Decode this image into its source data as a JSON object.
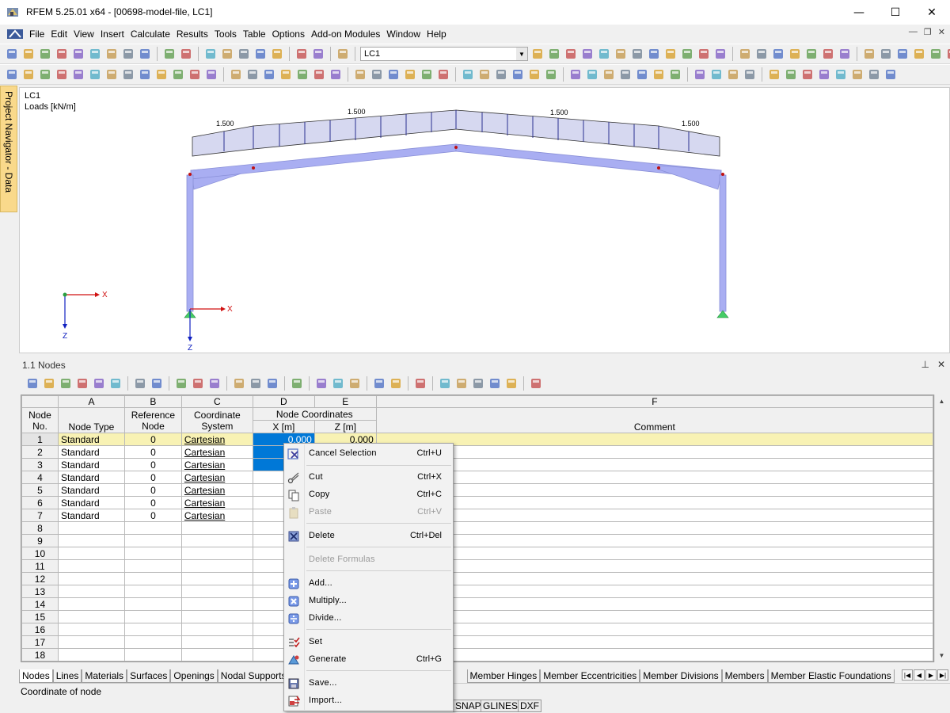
{
  "window": {
    "title": "RFEM 5.25.01 x64 - [00698-model-file, LC1]",
    "minimize": "—",
    "maximize": "☐",
    "close": "✕"
  },
  "menu": [
    "File",
    "Edit",
    "View",
    "Insert",
    "Calculate",
    "Results",
    "Tools",
    "Table",
    "Options",
    "Add-on Modules",
    "Window",
    "Help"
  ],
  "toolbar": {
    "loadcase": "LC1"
  },
  "navigator": {
    "label": "Project Navigator - Data"
  },
  "model": {
    "loadcase": "LC1",
    "units": "Loads [kN/m]",
    "load_labels": [
      "1.500",
      "1.500",
      "1.500",
      "1.500"
    ],
    "axis_x": "X",
    "axis_z": "Z"
  },
  "panel": {
    "title": "1.1 Nodes",
    "pin": "⊥",
    "close": "✕"
  },
  "table": {
    "col_letters": [
      "A",
      "B",
      "C",
      "D",
      "E",
      "F"
    ],
    "headers": {
      "node_no": "Node No.",
      "node_type": "Node Type",
      "reference_node": "Reference Node",
      "coordinate_system": "Coordinate System",
      "node_coordinates": "Node Coordinates",
      "x": "X [m]",
      "z": "Z [m]",
      "comment": "Comment"
    },
    "rows": [
      {
        "no": "1",
        "type": "Standard",
        "ref": "0",
        "cs": "Cartesian",
        "x": "0.000",
        "z": "0.000"
      },
      {
        "no": "2",
        "type": "Standard",
        "ref": "0",
        "cs": "Cartesian",
        "x": "",
        "z": ""
      },
      {
        "no": "3",
        "type": "Standard",
        "ref": "0",
        "cs": "Cartesian",
        "x": "",
        "z": ""
      },
      {
        "no": "4",
        "type": "Standard",
        "ref": "0",
        "cs": "Cartesian",
        "x": "",
        "z": ""
      },
      {
        "no": "5",
        "type": "Standard",
        "ref": "0",
        "cs": "Cartesian",
        "x": "",
        "z": ""
      },
      {
        "no": "6",
        "type": "Standard",
        "ref": "0",
        "cs": "Cartesian",
        "x": "",
        "z": ""
      },
      {
        "no": "7",
        "type": "Standard",
        "ref": "0",
        "cs": "Cartesian",
        "x": "",
        "z": ""
      },
      {
        "no": "8",
        "type": "",
        "ref": "",
        "cs": "",
        "x": "",
        "z": ""
      },
      {
        "no": "9",
        "type": "",
        "ref": "",
        "cs": "",
        "x": "",
        "z": ""
      },
      {
        "no": "10",
        "type": "",
        "ref": "",
        "cs": "",
        "x": "",
        "z": ""
      },
      {
        "no": "11",
        "type": "",
        "ref": "",
        "cs": "",
        "x": "",
        "z": ""
      },
      {
        "no": "12",
        "type": "",
        "ref": "",
        "cs": "",
        "x": "",
        "z": ""
      },
      {
        "no": "13",
        "type": "",
        "ref": "",
        "cs": "",
        "x": "",
        "z": ""
      },
      {
        "no": "14",
        "type": "",
        "ref": "",
        "cs": "",
        "x": "",
        "z": ""
      },
      {
        "no": "15",
        "type": "",
        "ref": "",
        "cs": "",
        "x": "",
        "z": ""
      },
      {
        "no": "16",
        "type": "",
        "ref": "",
        "cs": "",
        "x": "",
        "z": ""
      },
      {
        "no": "17",
        "type": "",
        "ref": "",
        "cs": "",
        "x": "",
        "z": ""
      },
      {
        "no": "18",
        "type": "",
        "ref": "",
        "cs": "",
        "x": "",
        "z": ""
      }
    ]
  },
  "sheet_tabs": [
    "Nodes",
    "Lines",
    "Materials",
    "Surfaces",
    "Openings",
    "Nodal Supports",
    "Lin",
    "Member Hinges",
    "Member Eccentricities",
    "Member Divisions",
    "Members",
    "Member Elastic Foundations"
  ],
  "status": {
    "text": "Coordinate of node",
    "toggles": [
      "SNAP",
      "GLINES",
      "DXF"
    ]
  },
  "context_menu": {
    "items": [
      {
        "label": "Cancel Selection",
        "shortcut": "Ctrl+U",
        "icon": "cancel-selection-icon",
        "disabled": false
      },
      {
        "label": "Cut",
        "shortcut": "Ctrl+X",
        "icon": "scissors-icon",
        "disabled": false
      },
      {
        "label": "Copy",
        "shortcut": "Ctrl+C",
        "icon": "copy-icon",
        "disabled": false
      },
      {
        "label": "Paste",
        "shortcut": "Ctrl+V",
        "icon": "paste-icon",
        "disabled": true
      },
      {
        "label": "Delete",
        "shortcut": "Ctrl+Del",
        "icon": "delete-icon",
        "disabled": false
      },
      {
        "label": "Delete Formulas",
        "shortcut": "",
        "icon": "",
        "disabled": true
      },
      {
        "label": "Add...",
        "shortcut": "",
        "icon": "add-icon",
        "disabled": false
      },
      {
        "label": "Multiply...",
        "shortcut": "",
        "icon": "multiply-icon",
        "disabled": false
      },
      {
        "label": "Divide...",
        "shortcut": "",
        "icon": "divide-icon",
        "disabled": false
      },
      {
        "label": "Set",
        "shortcut": "",
        "icon": "set-icon",
        "disabled": false
      },
      {
        "label": "Generate",
        "shortcut": "Ctrl+G",
        "icon": "generate-icon",
        "disabled": false
      },
      {
        "label": "Save...",
        "shortcut": "",
        "icon": "save-icon",
        "disabled": false
      },
      {
        "label": "Import...",
        "shortcut": "",
        "icon": "import-icon",
        "disabled": false
      }
    ]
  },
  "colors": {
    "member": "#a9aef2",
    "load": "#d6d8f0",
    "selection": "#0078d7",
    "highlight_row": "#f8f2b4",
    "support": "#44cc66"
  }
}
